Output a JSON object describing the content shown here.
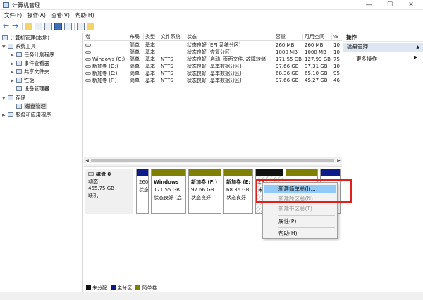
{
  "window": {
    "title": "计算机管理",
    "controls": {
      "minimize": "—",
      "maximize": "☐",
      "close": "✕"
    }
  },
  "menu": [
    "文件(F)",
    "操作(A)",
    "查看(V)",
    "帮助(H)"
  ],
  "tree": {
    "root": "计算机管理(本地)",
    "system_tools": "系统工具",
    "task_scheduler": "任务计划程序",
    "event_viewer": "事件查看器",
    "shared_folders": "共享文件夹",
    "performance": "性能",
    "device_manager": "设备管理器",
    "storage": "存储",
    "disk_management": "磁盘管理",
    "services_apps": "服务和应用程序"
  },
  "volume_list": {
    "columns": [
      "卷",
      "布局",
      "类型",
      "文件系统",
      "状态",
      "容量",
      "可用空间",
      "%"
    ],
    "rows": [
      [
        "",
        "简单",
        "基本",
        "",
        "状态良好 (EFI 系统分区)",
        "260 MB",
        "260 MB",
        "10"
      ],
      [
        "",
        "简单",
        "基本",
        "",
        "状态良好 (恢复分区)",
        "1000 MB",
        "1000 MB",
        "10"
      ],
      [
        "Windows (C:)",
        "简单",
        "基本",
        "NTFS",
        "状态良好 (启动, 页面文件, 故障转储",
        "171.55 GB",
        "127.99 GB",
        "75"
      ],
      [
        "新加卷 (D:)",
        "简单",
        "基本",
        "NTFS",
        "状态良好 (基本数据分区)",
        "97.66 GB",
        "97.31 GB",
        "10"
      ],
      [
        "新加卷 (E:)",
        "简单",
        "基本",
        "NTFS",
        "状态良好 (基本数据分区)",
        "68.36 GB",
        "65.10 GB",
        "95"
      ],
      [
        "新加卷 (F:)",
        "简单",
        "基本",
        "NTFS",
        "状态良好 (基本数据分区)",
        "97.66 GB",
        "45.27 GB",
        "46"
      ]
    ]
  },
  "disk0": {
    "name": "磁盘 0",
    "type": "动态",
    "size": "465.75 GB",
    "status": "联机",
    "partitions": [
      {
        "title": "",
        "size": "260",
        "status": "状态",
        "color": "#0c1a8c"
      },
      {
        "title": "Windows",
        "size": "171.55 GB",
        "status": "状态良好 (启",
        "color": "#808000"
      },
      {
        "title": "新加卷 (F:)",
        "size": "97.66 GB",
        "status": "状态良好",
        "color": "#808000"
      },
      {
        "title": "新加卷 (E:",
        "size": "68.36 GB",
        "status": "状态良好",
        "color": "#808000"
      },
      {
        "title": "",
        "size": "29",
        "status": "未",
        "color": "#111111"
      },
      {
        "title": "",
        "size": "",
        "status": "",
        "color": "#808000"
      },
      {
        "title": "",
        "size": "",
        "status": "",
        "color": "#0c1a8c"
      }
    ]
  },
  "legend": [
    {
      "label": "未分配",
      "color": "#111111"
    },
    {
      "label": "主分区",
      "color": "#0c1a8c"
    },
    {
      "label": "简单卷",
      "color": "#808000"
    }
  ],
  "actions": {
    "title": "操作",
    "section": "磁盘管理",
    "more": "更多操作"
  },
  "context_menu": {
    "new_simple": "新建简单卷(I)...",
    "new_spanned": "新建跨区卷(N)...",
    "new_striped": "新建带区卷(T)...",
    "properties": "属性(P)",
    "help": "帮助(H)"
  }
}
